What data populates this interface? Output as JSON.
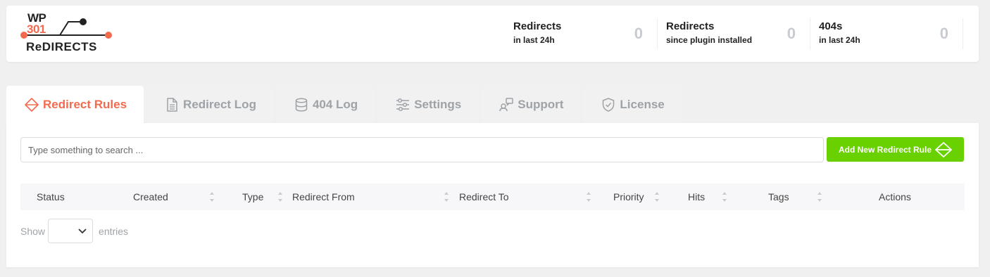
{
  "logo": {
    "line1": "WP",
    "line2": "301",
    "line3": "ReDIRECTS"
  },
  "stats": [
    {
      "title": "Redirects",
      "subtitle": "in last 24h",
      "value": "0"
    },
    {
      "title": "Redirects",
      "subtitle": "since plugin installed",
      "value": "0"
    },
    {
      "title": "404s",
      "subtitle": "in last 24h",
      "value": "0"
    }
  ],
  "tabs": [
    {
      "label": "Redirect Rules",
      "icon": "redirect-rules-icon",
      "active": true
    },
    {
      "label": "Redirect Log",
      "icon": "document-icon",
      "active": false
    },
    {
      "label": "404 Log",
      "icon": "database-icon",
      "active": false
    },
    {
      "label": "Settings",
      "icon": "sliders-icon",
      "active": false
    },
    {
      "label": "Support",
      "icon": "support-icon",
      "active": false
    },
    {
      "label": "License",
      "icon": "shield-check-icon",
      "active": false
    }
  ],
  "search": {
    "placeholder": "Type something to search ..."
  },
  "add_button": {
    "label": "Add New Redirect Rule",
    "icon": "redirect-rules-icon"
  },
  "table": {
    "columns": [
      "Status",
      "Created",
      "Type",
      "Redirect From",
      "Redirect To",
      "Priority",
      "Hits",
      "Tags",
      "Actions"
    ]
  },
  "entries": {
    "prefix": "Show",
    "suffix": "entries"
  },
  "colors": {
    "accent": "#f26b4f",
    "button": "#6ad100",
    "muted": "#9ea3a8"
  }
}
